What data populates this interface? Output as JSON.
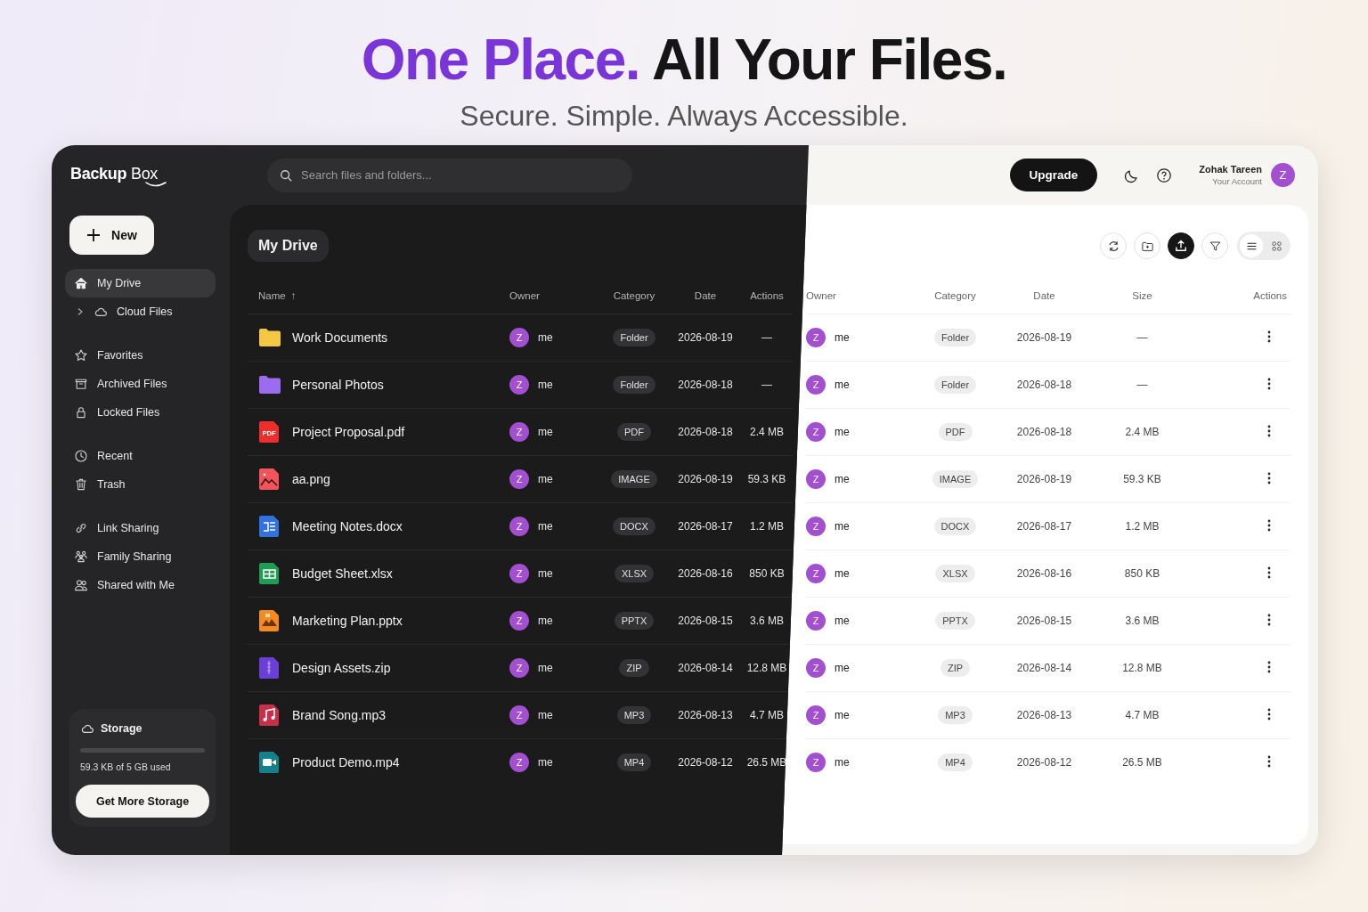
{
  "headline": {
    "accent": "One Place.",
    "rest": "All Your Files."
  },
  "subtitle": "Secure. Simple. Always Accessible.",
  "logo": {
    "bold": "Backup",
    "regular": "Box"
  },
  "search": {
    "placeholder": "Search files and folders..."
  },
  "new_button": "New",
  "sidebar": {
    "groups": [
      {
        "items": [
          {
            "label": "My Drive",
            "selected": true,
            "children": [
              {
                "label": "Cloud Files",
                "selected": false,
                "expanded": false
              }
            ]
          }
        ]
      },
      {
        "items": [
          {
            "label": "Favorites",
            "selected": false
          },
          {
            "label": "Archived Files",
            "selected": false
          },
          {
            "label": "Locked Files",
            "selected": false
          }
        ]
      },
      {
        "items": [
          {
            "label": "Recent",
            "selected": false
          },
          {
            "label": "Trash",
            "selected": false
          }
        ]
      },
      {
        "items": [
          {
            "label": "Link Sharing",
            "selected": false
          },
          {
            "label": "Family Sharing",
            "selected": false
          },
          {
            "label": "Shared with Me",
            "selected": false
          }
        ]
      }
    ]
  },
  "storage": {
    "title": "Storage",
    "level": 0,
    "usage": "59.3 KB of 5 GB used",
    "button": "Get More Storage"
  },
  "dark_view": {
    "title": "My Drive",
    "sort_arrow": "↑",
    "columns": [
      "Name",
      "Owner",
      "Category",
      "Date",
      "Actions"
    ],
    "rows": [
      {
        "name": "Work Documents",
        "kind": "folder",
        "color": "#f5c842",
        "avatar": "Z",
        "owner": "me",
        "category": "Folder",
        "date": "2026-08-19",
        "size": "—"
      },
      {
        "name": "Personal Photos",
        "kind": "folder",
        "color": "#9b6bf0",
        "avatar": "Z",
        "owner": "me",
        "category": "Folder",
        "date": "2026-08-18",
        "size": "—"
      },
      {
        "name": "Project Proposal.pdf",
        "kind": "pdf",
        "color": "#f02d2d",
        "icon_text": "PDF",
        "avatar": "Z",
        "owner": "me",
        "category": "PDF",
        "date": "2026-08-18",
        "size": "2.4 MB"
      },
      {
        "name": "aa.png",
        "kind": "image",
        "color": "#f2545b",
        "avatar": "Z",
        "owner": "me",
        "category": "IMAGE",
        "date": "2026-08-19",
        "size": "59.3 KB"
      },
      {
        "name": "Meeting Notes.docx",
        "kind": "doc",
        "color": "#2f72e0",
        "avatar": "Z",
        "owner": "me",
        "category": "DOCX",
        "date": "2026-08-17",
        "size": "1.2 MB"
      },
      {
        "name": "Budget Sheet.xlsx",
        "kind": "sheet",
        "color": "#1f9d55",
        "avatar": "Z",
        "owner": "me",
        "category": "XLSX",
        "date": "2026-08-16",
        "size": "850 KB"
      },
      {
        "name": "Marketing Plan.pptx",
        "kind": "slides",
        "color": "#f58a1f",
        "avatar": "Z",
        "owner": "me",
        "category": "PPTX",
        "date": "2026-08-15",
        "size": "3.6 MB"
      },
      {
        "name": "Design Assets.zip",
        "kind": "archive",
        "color": "#6a3fd6",
        "avatar": "Z",
        "owner": "me",
        "category": "ZIP",
        "date": "2026-08-14",
        "size": "12.8 MB"
      },
      {
        "name": "Brand Song.mp3",
        "kind": "audio",
        "color": "#c8304a",
        "avatar": "Z",
        "owner": "me",
        "category": "MP3",
        "date": "2026-08-13",
        "size": "4.7 MB"
      },
      {
        "name": "Product Demo.mp4",
        "kind": "video",
        "color": "#16808a",
        "avatar": "Z",
        "owner": "me",
        "category": "MP4",
        "date": "2026-08-12",
        "size": "26.5 MB"
      }
    ]
  },
  "top_bar": {
    "upgrade": "Upgrade",
    "user_name": "Zohak Tareen",
    "user_subtitle": "Your Account",
    "avatar": "Z"
  },
  "view_toggle": [
    {
      "kind": "list",
      "selected": true
    },
    {
      "kind": "grid",
      "selected": false
    }
  ],
  "light_view": {
    "columns": [
      "Owner",
      "Category",
      "Date",
      "Size",
      "Actions"
    ],
    "rows": [
      {
        "avatar": "Z",
        "owner": "me",
        "category": "Folder",
        "date": "2026-08-19",
        "size": "—"
      },
      {
        "avatar": "Z",
        "owner": "me",
        "category": "Folder",
        "date": "2026-08-18",
        "size": "—"
      },
      {
        "avatar": "Z",
        "owner": "me",
        "category": "PDF",
        "date": "2026-08-18",
        "size": "2.4 MB"
      },
      {
        "avatar": "Z",
        "owner": "me",
        "category": "IMAGE",
        "date": "2026-08-19",
        "size": "59.3 KB"
      },
      {
        "avatar": "Z",
        "owner": "me",
        "category": "DOCX",
        "date": "2026-08-17",
        "size": "1.2 MB"
      },
      {
        "avatar": "Z",
        "owner": "me",
        "category": "XLSX",
        "date": "2026-08-16",
        "size": "850 KB"
      },
      {
        "avatar": "Z",
        "owner": "me",
        "category": "PPTX",
        "date": "2026-08-15",
        "size": "3.6 MB"
      },
      {
        "avatar": "Z",
        "owner": "me",
        "category": "ZIP",
        "date": "2026-08-14",
        "size": "12.8 MB"
      },
      {
        "avatar": "Z",
        "owner": "me",
        "category": "MP3",
        "date": "2026-08-13",
        "size": "4.7 MB"
      },
      {
        "avatar": "Z",
        "owner": "me",
        "category": "MP4",
        "date": "2026-08-12",
        "size": "26.5 MB"
      }
    ]
  }
}
